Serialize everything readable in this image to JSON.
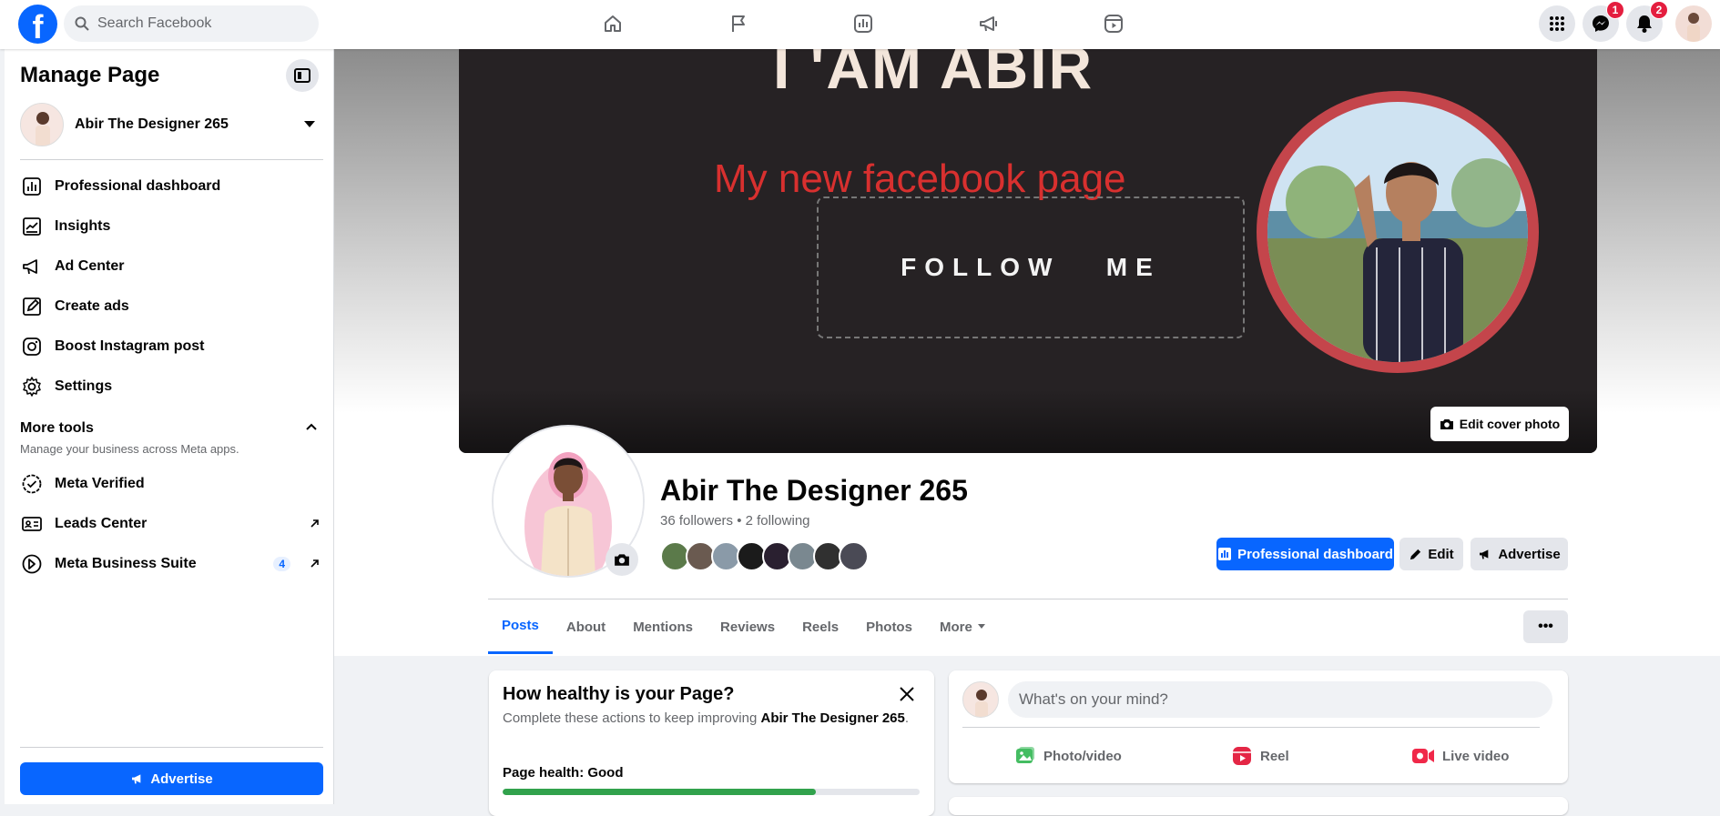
{
  "topbar": {
    "logo": "f",
    "search_placeholder": "Search Facebook",
    "nav_icons": [
      "home-icon",
      "flag-icon",
      "insights-icon",
      "megaphone-icon",
      "reels-icon"
    ],
    "messenger_badge": "1",
    "notifications_badge": "2"
  },
  "sidebar": {
    "title": "Manage Page",
    "page_name": "Abir The Designer 265",
    "items": [
      {
        "label": "Professional dashboard",
        "icon": "dashboard-icon"
      },
      {
        "label": "Insights",
        "icon": "insights-icon"
      },
      {
        "label": "Ad Center",
        "icon": "megaphone-icon"
      },
      {
        "label": "Create ads",
        "icon": "pencil-icon"
      },
      {
        "label": "Boost Instagram post",
        "icon": "instagram-icon"
      },
      {
        "label": "Settings",
        "icon": "gear-icon"
      }
    ],
    "more_tools": {
      "title": "More tools",
      "subtitle": "Manage your business across Meta apps."
    },
    "tools": [
      {
        "label": "Meta Verified",
        "icon": "verified-icon"
      },
      {
        "label": "Leads Center",
        "icon": "contact-card-icon"
      },
      {
        "label": "Meta Business Suite",
        "icon": "meta-business-icon",
        "badge": "4"
      }
    ],
    "advertise_label": "Advertise"
  },
  "cover": {
    "headline": "I 'AM ABIR",
    "subline": "My new facebook page",
    "cta": "FOLLOW   ME",
    "edit_label": "Edit cover photo"
  },
  "profile": {
    "name": "Abir The Designer 265",
    "stats": "36 followers • 2 following",
    "buttons": {
      "dashboard": "Professional dashboard",
      "edit": "Edit",
      "advertise": "Advertise"
    },
    "follower_colors": [
      "#5b7a4a",
      "#6a5a50",
      "#8a9aa8",
      "#1b1b1b",
      "#2a2030",
      "#7a8890",
      "#303030",
      "#4a4a55"
    ]
  },
  "tabs": {
    "items": [
      "Posts",
      "About",
      "Mentions",
      "Reviews",
      "Reels",
      "Photos",
      "More"
    ],
    "active": "Posts",
    "overflow": "•••"
  },
  "health_card": {
    "title": "How healthy is your Page?",
    "subtitle_prefix": "Complete these actions to keep improving ",
    "subtitle_bold": "Abir The Designer 265",
    "subtitle_suffix": ".",
    "health_label": "Page health: Good",
    "health_fraction": 0.75
  },
  "post_composer": {
    "placeholder": "What's on your mind?",
    "actions": [
      {
        "label": "Photo/video",
        "color": "#45bd62"
      },
      {
        "label": "Reel",
        "color": "#e42645"
      },
      {
        "label": "Live video",
        "color": "#f02849"
      }
    ]
  },
  "colors": {
    "accent": "#0866ff",
    "good": "#31a24c",
    "cover_ring": "#c4454b",
    "cover_red_text": "#d8302f"
  }
}
